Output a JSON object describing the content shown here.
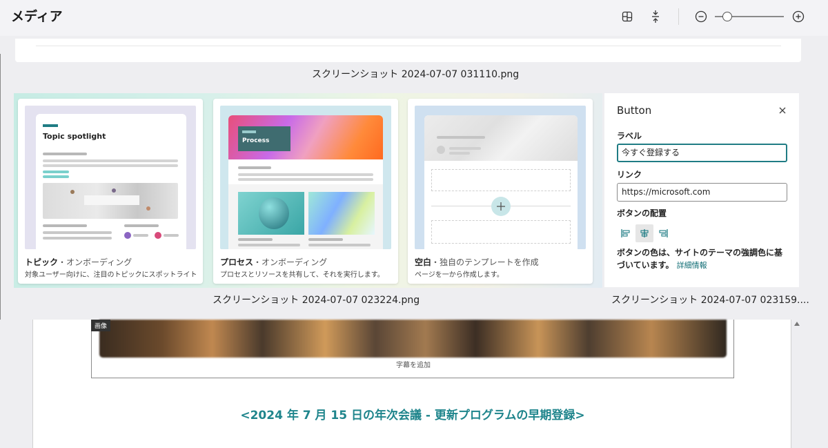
{
  "header": {
    "title": "メディア",
    "toolbar_icons": [
      "layout-grid-icon",
      "fit-height-icon",
      "zoom-out-icon",
      "zoom-slider",
      "zoom-in-icon"
    ],
    "zoom_level": 0.15
  },
  "screenshots": [
    {
      "name": "スクリーンショット 2024-07-07 031110.png"
    },
    {
      "name": "スクリーンショット 2024-07-07 023224.png"
    },
    {
      "name": "スクリーンショット 2024-07-07 023159...."
    }
  ],
  "templates": [
    {
      "name": "トピック",
      "category": "オンボーディング",
      "description": "対象ユーザー向けに、注目のトピックにスポットライト",
      "thumb_title": "Topic spotlight"
    },
    {
      "name": "プロセス",
      "category": "オンボーディング",
      "description": "プロセスとリソースを共有して、それを実行します。",
      "thumb_title": "Process"
    },
    {
      "name": "空白",
      "category": "独自のテンプレートを作成",
      "description": "ページを一から作成します。"
    }
  ],
  "template_separator": "・",
  "button_panel": {
    "title": "Button",
    "label_heading": "ラベル",
    "label_value": "今すぐ登録する",
    "link_heading": "リンク",
    "link_value": "https://microsoft.com",
    "alignment_heading": "ボタンの配置",
    "alignment_options": [
      "align-left-icon",
      "align-center-icon",
      "align-right-icon"
    ],
    "alignment_selected": "align-center-icon",
    "note": "ボタンの色は、サイトのテーマの強調色に基づいています。",
    "note_link": "詳細情報"
  },
  "editor": {
    "image_tag": "画像",
    "caption_placeholder": "字幕を追加",
    "headline": "<2024 年 7 月 15 日の年次会議 - 更新プログラムの早期登録>"
  },
  "colors": {
    "accent": "#1f858c",
    "input_focus": "#1f7c84",
    "topic_accent": "#1f7c84"
  }
}
